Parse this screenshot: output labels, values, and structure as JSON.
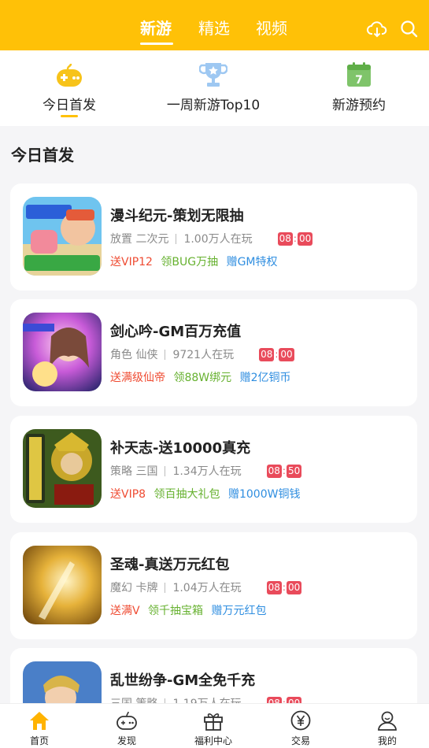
{
  "header": {
    "tabs": [
      "新游",
      "精选",
      "视频"
    ],
    "active_tab": "新游"
  },
  "categories": [
    {
      "label": "今日首发",
      "icon": "gamepad-icon"
    },
    {
      "label": "一周新游Top10",
      "icon": "trophy-icon"
    },
    {
      "label": "新游预约",
      "icon": "calendar-icon",
      "icon_text": "7"
    }
  ],
  "section": {
    "title": "今日首发"
  },
  "games": [
    {
      "name": "漫斗纪元-策划无限抽",
      "genre": "放置 二次元",
      "players": "1.00万人在玩",
      "time_h": "08",
      "time_m": "00",
      "tags": [
        "送VIP12",
        "领BUG万抽",
        "赠GM特权"
      ]
    },
    {
      "name": "剑心吟-GM百万充值",
      "genre": "角色 仙侠",
      "players": "9721人在玩",
      "time_h": "08",
      "time_m": "00",
      "tags": [
        "送满级仙帝",
        "领88W绑元",
        "赠2亿铜币"
      ]
    },
    {
      "name": "补天志-送10000真充",
      "genre": "策略 三国",
      "players": "1.34万人在玩",
      "time_h": "08",
      "time_m": "50",
      "tags": [
        "送VIP8",
        "领百抽大礼包",
        "赠1000W铜钱"
      ]
    },
    {
      "name": "圣魂-真送万元红包",
      "genre": "魔幻 卡牌",
      "players": "1.04万人在玩",
      "time_h": "08",
      "time_m": "00",
      "tags": [
        "送满V",
        "领千抽宝箱",
        "赠万元红包"
      ]
    },
    {
      "name": "乱世纷争-GM全免千充",
      "genre": "三国 策略",
      "players": "1.19万人在玩",
      "time_h": "08",
      "time_m": "00",
      "tags": [
        "",
        "",
        ""
      ]
    }
  ],
  "bottom_nav": [
    {
      "label": "首页",
      "icon": "home-icon"
    },
    {
      "label": "发现",
      "icon": "gamepad-icon"
    },
    {
      "label": "福利中心",
      "icon": "gift-icon"
    },
    {
      "label": "交易",
      "icon": "yen-icon"
    },
    {
      "label": "我的",
      "icon": "user-icon"
    }
  ],
  "colors": {
    "accent": "#ffc107",
    "timer": "#e94b5b",
    "tag_red": "#ef4b32",
    "tag_green": "#66b12f",
    "tag_blue": "#2f8ee0"
  }
}
